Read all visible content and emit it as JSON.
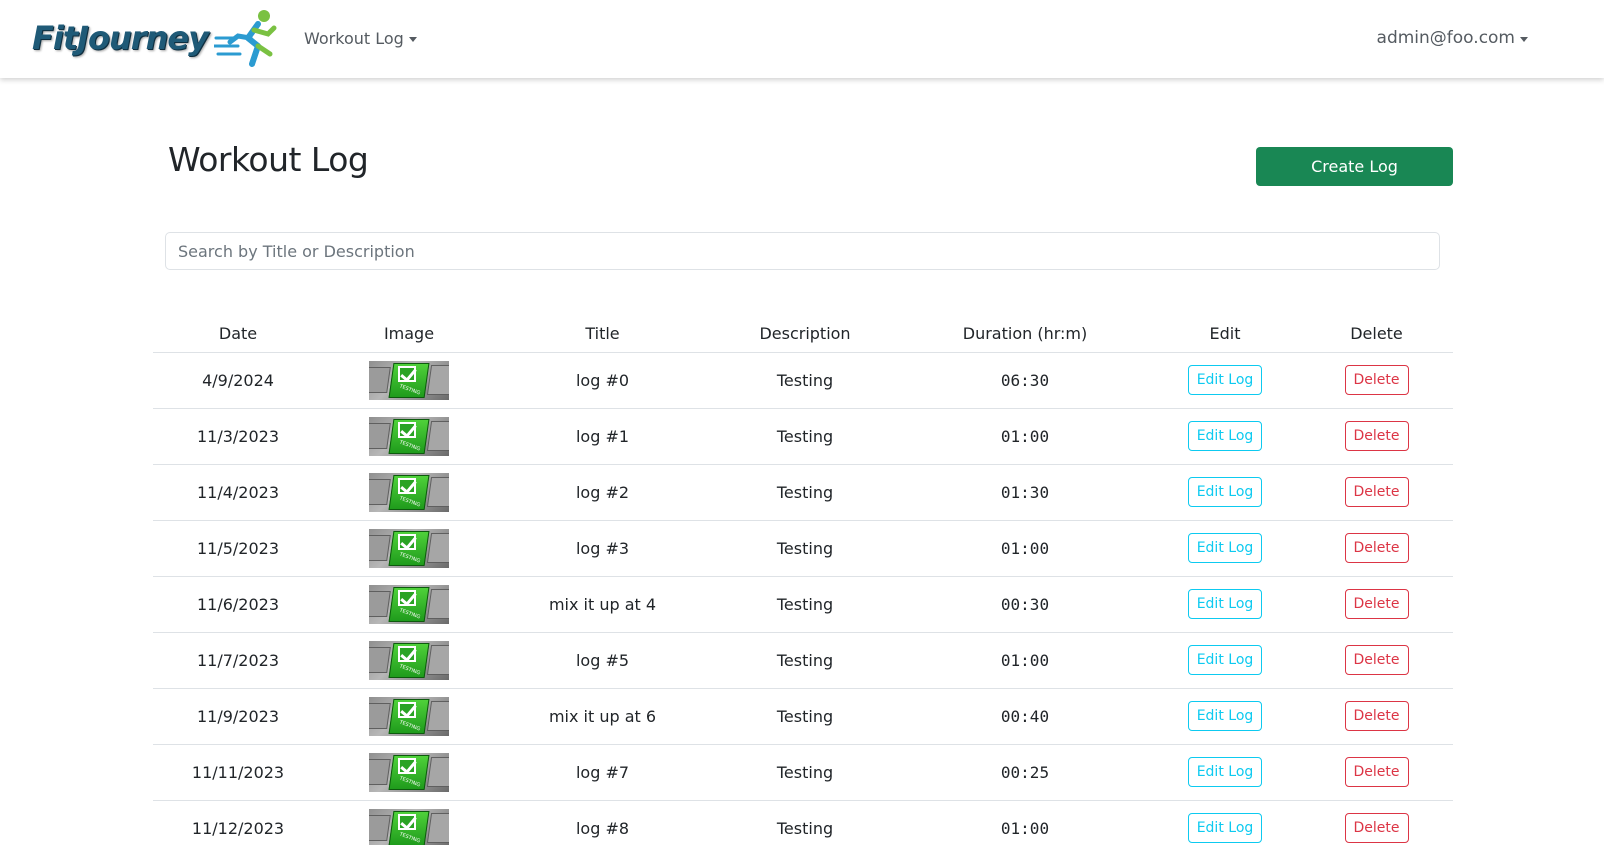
{
  "nav": {
    "brand": "FitJourney",
    "workout_menu": "Workout Log",
    "user_menu": "admin@foo.com"
  },
  "header": {
    "title": "Workout Log",
    "create_label": "Create Log"
  },
  "search": {
    "placeholder": "Search by Title or Description"
  },
  "table": {
    "columns": [
      "Date",
      "Image",
      "Title",
      "Description",
      "Duration (hr:m)",
      "Edit",
      "Delete"
    ],
    "edit_label": "Edit Log",
    "delete_label": "Delete",
    "image_text": "TESTING",
    "rows": [
      {
        "date": "4/9/2024",
        "title": "log #0",
        "description": "Testing",
        "duration": "06:30"
      },
      {
        "date": "11/3/2023",
        "title": "log #1",
        "description": "Testing",
        "duration": "01:00"
      },
      {
        "date": "11/4/2023",
        "title": "log #2",
        "description": "Testing",
        "duration": "01:30"
      },
      {
        "date": "11/5/2023",
        "title": "log #3",
        "description": "Testing",
        "duration": "01:00"
      },
      {
        "date": "11/6/2023",
        "title": "mix it up at 4",
        "description": "Testing",
        "duration": "00:30"
      },
      {
        "date": "11/7/2023",
        "title": "log #5",
        "description": "Testing",
        "duration": "01:00"
      },
      {
        "date": "11/9/2023",
        "title": "mix it up at 6",
        "description": "Testing",
        "duration": "00:40"
      },
      {
        "date": "11/11/2023",
        "title": "log #7",
        "description": "Testing",
        "duration": "00:25"
      },
      {
        "date": "11/12/2023",
        "title": "log #8",
        "description": "Testing",
        "duration": "01:00"
      }
    ]
  },
  "colors": {
    "primary_green": "#198754",
    "edit_cyan": "#0dcaf0",
    "delete_red": "#dc3545",
    "brand_blue": "#1f5a77"
  }
}
